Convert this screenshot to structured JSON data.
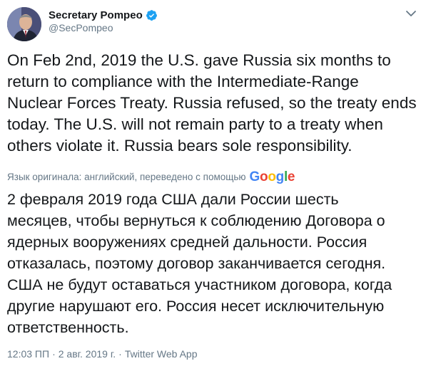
{
  "author": {
    "display_name": "Secretary Pompeo",
    "handle": "@SecPompeo",
    "verified": true,
    "avatar_icon": "person-avatar"
  },
  "menu": {
    "icon": "chevron-down-icon"
  },
  "tweet": {
    "original_lines": [
      "On Feb 2nd, 2019 the U.S. gave Russia six months to",
      "return to compliance with the Intermediate-Range",
      "Nuclear Forces Treaty. Russia refused, so the treaty ends",
      "today. The U.S. will not remain party to a treaty when",
      "others violate it. Russia bears sole responsibility."
    ],
    "translation_label": "Язык оригинала: английский, переведено с помощью",
    "translation_provider": "Google",
    "translated_lines": [
      "2 февраля 2019 года США дали России шесть",
      "месяцев, чтобы вернуться к соблюдению Договора о",
      "ядерных вооружениях средней дальности. Россия",
      "отказалась, поэтому договор заканчивается сегодня.",
      "США не будут оставаться участником договора, когда",
      "другие нарушают его. Россия несет исключительную",
      "ответственность."
    ]
  },
  "meta": {
    "time": "12:03 ПП",
    "separator": "·",
    "date": "2 авг. 2019 г.",
    "source": "Twitter Web App"
  },
  "colors": {
    "text": "#14171a",
    "secondary": "#657786",
    "verified_badge": "#1da1f2",
    "google_blue": "#4285f4",
    "google_red": "#ea4335",
    "google_yellow": "#fbbc05",
    "google_green": "#34a853"
  }
}
